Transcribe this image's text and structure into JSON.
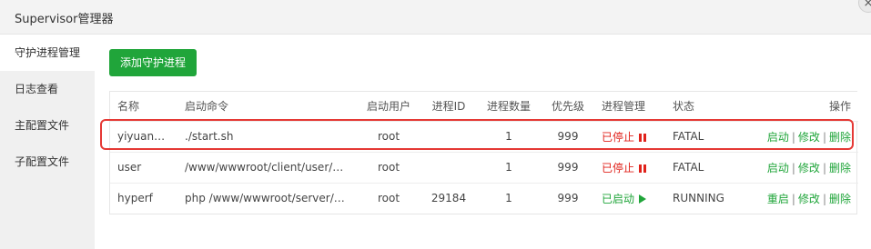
{
  "window": {
    "title": "Supervisor管理器",
    "close": "×"
  },
  "sidebar": {
    "items": [
      {
        "label": "守护进程管理"
      },
      {
        "label": "日志查看"
      },
      {
        "label": "主配置文件"
      },
      {
        "label": "子配置文件"
      }
    ]
  },
  "toolbar": {
    "add_label": "添加守护进程"
  },
  "table": {
    "headers": {
      "name": "名称",
      "cmd": "启动命令",
      "user": "启动用户",
      "pid": "进程ID",
      "count": "进程数量",
      "priority": "优先级",
      "manage": "进程管理",
      "status": "状态",
      "ops": "操作"
    },
    "rows": [
      {
        "name": "yiyuan…",
        "cmd": "./start.sh",
        "user": "root",
        "pid": "",
        "count": "1",
        "priority": "999",
        "manage": "已停止",
        "status": "FATAL",
        "op1": "启动",
        "op2": "修改",
        "op3": "删除"
      },
      {
        "name": "user",
        "cmd": "/www/wwwroot/client/user/start.…",
        "user": "root",
        "pid": "",
        "count": "1",
        "priority": "999",
        "manage": "已停止",
        "status": "FATAL",
        "op1": "启动",
        "op2": "修改",
        "op3": "删除"
      },
      {
        "name": "hyperf",
        "cmd": "php /www/wwwroot/server/yiyu…",
        "user": "root",
        "pid": "29184",
        "count": "1",
        "priority": "999",
        "manage": "已启动",
        "status": "RUNNING",
        "op1": "重启",
        "op2": "修改",
        "op3": "删除"
      }
    ],
    "separator": "|"
  },
  "colors": {
    "accent": "#20a53a",
    "stopped": "#e0221b",
    "highlight": "#e53935"
  }
}
